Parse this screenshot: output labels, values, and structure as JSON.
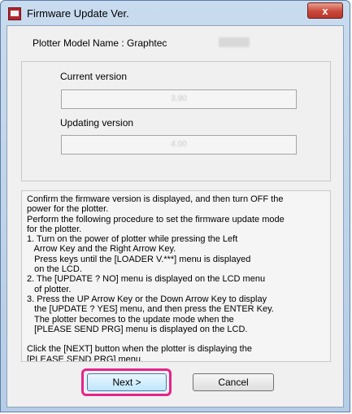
{
  "window": {
    "title": "Firmware Update Ver.",
    "close_glyph": "x"
  },
  "model": {
    "label": "Plotter Model Name : Graphtec"
  },
  "versions": {
    "current_label": "Current version",
    "current_value": "3.90",
    "updating_label": "Updating version",
    "updating_value": "4.00"
  },
  "instructions": {
    "text": "Confirm the firmware version is displayed, and then turn OFF the\npower for the plotter.\nPerform the following procedure to set the firmware update mode\nfor the plotter.\n1. Turn on the power of plotter while pressing the Left\n   Arrow Key and the Right Arrow Key.\n   Press keys until the [LOADER V.***] menu is displayed\n   on the LCD.\n2. The [UPDATE ? NO] menu is displayed on the LCD menu\n   of plotter.\n3. Press the UP Arrow Key or the Down Arrow Key to display\n   the [UPDATE ? YES] menu, and then press the ENTER Key.\n   The plotter becomes to the update mode when the\n   [PLEASE SEND PRG] menu is displayed on the LCD.\n\nClick the [NEXT] button when the plotter is displaying the\n[PLEASE SEND PRG] menu."
  },
  "buttons": {
    "next_label": "Next >",
    "cancel_label": "Cancel"
  },
  "colors": {
    "highlight": "#e5248c",
    "titlebar": "#c9dbee",
    "close_button": "#c9483a"
  }
}
